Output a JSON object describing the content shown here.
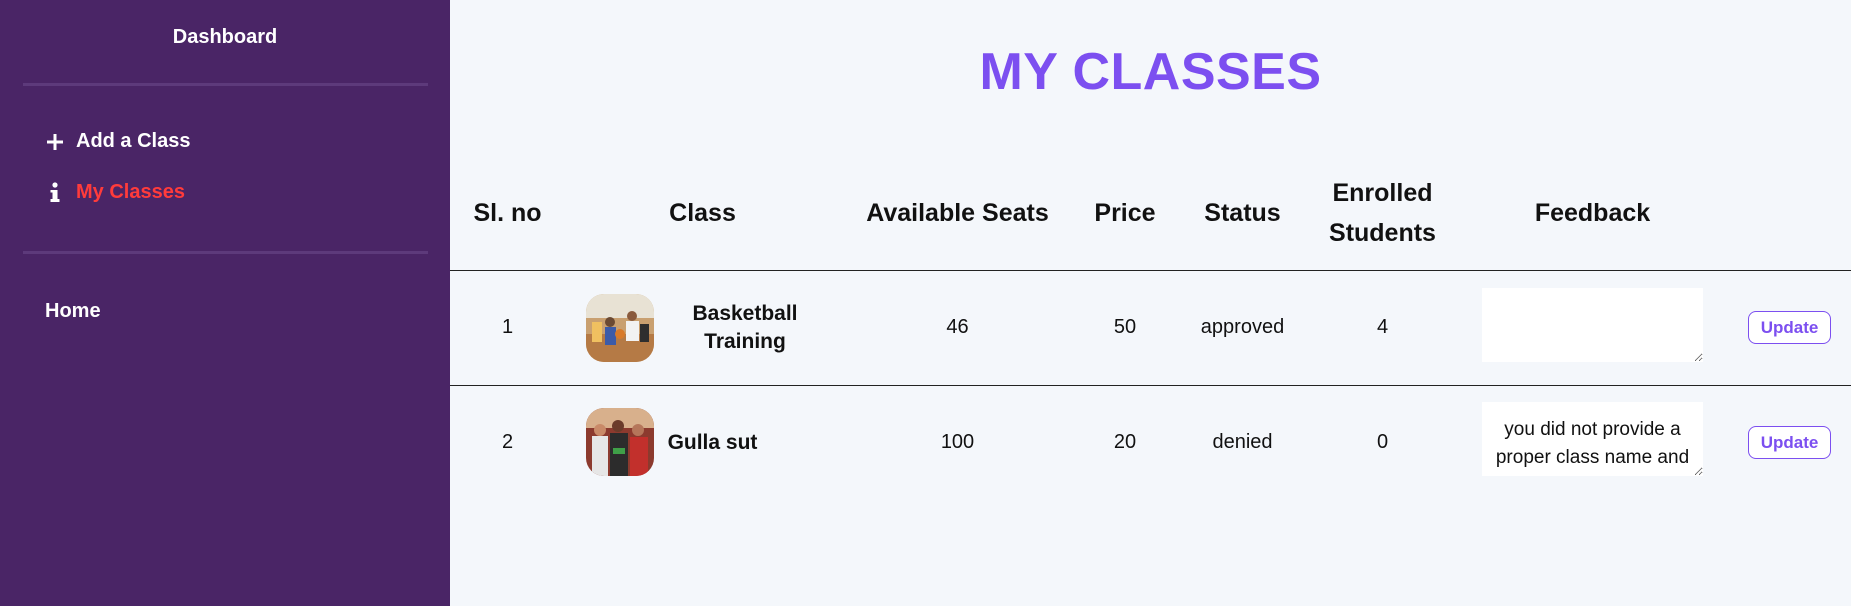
{
  "sidebar": {
    "title": "Dashboard",
    "items": [
      {
        "label": "Add a Class",
        "icon": "plus-icon"
      },
      {
        "label": "My Classes",
        "icon": "info-icon",
        "active": true
      }
    ],
    "home_label": "Home",
    "active_color": "#ff3b3b",
    "background": "#4a2566"
  },
  "main": {
    "title": "MY CLASSES",
    "title_color": "#7c4ff0",
    "table": {
      "headers": {
        "sl": "Sl. no",
        "class": "Class",
        "seats": "Available Seats",
        "price": "Price",
        "status": "Status",
        "enrolled_line1": "Enrolled",
        "enrolled_line2": "Students",
        "feedback": "Feedback"
      },
      "rows": [
        {
          "sl": "1",
          "class_line1": "Basketball",
          "class_line2": "Training",
          "seats": "46",
          "price": "50",
          "status": "approved",
          "enrolled": "4",
          "feedback": "",
          "action": "Update"
        },
        {
          "sl": "2",
          "class_line1": "Gulla sut",
          "class_line2": "",
          "seats": "100",
          "price": "20",
          "status": "denied",
          "enrolled": "0",
          "feedback": "you did not provide a proper class name and",
          "action": "Update"
        }
      ]
    }
  }
}
